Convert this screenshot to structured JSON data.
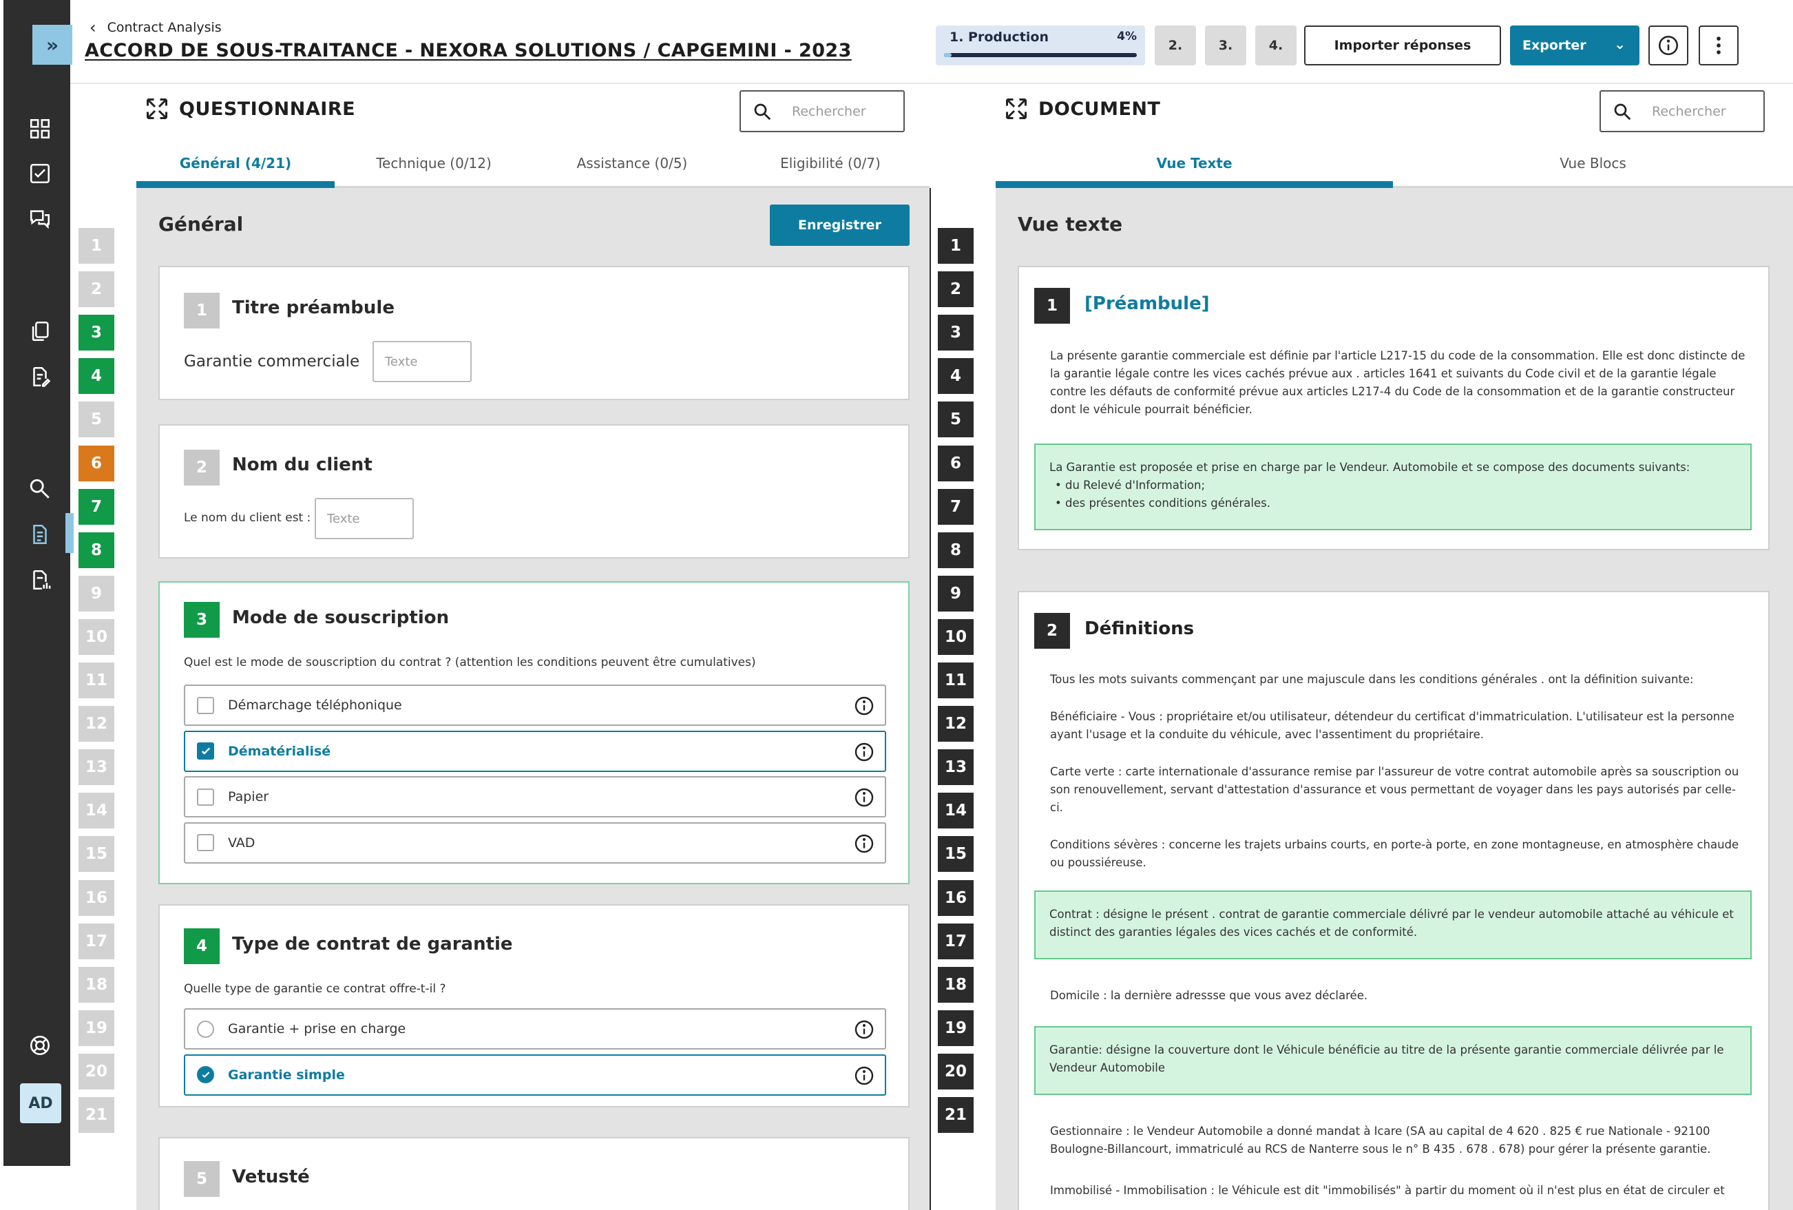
{
  "header": {
    "breadcrumb": "Contract Analysis",
    "title": "ACCORD DE SOUS-TRAITANCE - NEXORA SOLUTIONS / CAPGEMINI - 2023",
    "production_label": "1. Production",
    "production_pct": "4%",
    "production_progress": 0.04,
    "steps": [
      "2.",
      "3.",
      "4."
    ],
    "import_label": "Importer réponses",
    "export_label": "Exporter"
  },
  "sidebar": {
    "expand_glyph": "»",
    "avatar": "AD",
    "icons": [
      "grid-icon",
      "checkbox-icon",
      "chat-icon",
      "copy-icon",
      "file-edit-icon",
      "search-icon",
      "file-list-icon",
      "file-chart-icon",
      "help-icon"
    ]
  },
  "questionnaire": {
    "heading": "QUESTIONNAIRE",
    "search_placeholder": "Rechercher",
    "tabs": [
      "Général (4/21)",
      "Technique (0/12)",
      "Assistance (0/5)",
      "Eligibilité (0/7)"
    ],
    "section_title": "Général",
    "save_label": "Enregistrer",
    "questions": [
      {
        "num": "1",
        "title": "Titre préambule",
        "field_label": "Garantie commerciale",
        "placeholder": "Texte"
      },
      {
        "num": "2",
        "title": "Nom du client",
        "field_label": "Le nom du client est :",
        "placeholder": "Texte"
      },
      {
        "num": "3",
        "title": "Mode de souscription",
        "prompt": "Quel est le mode de souscription du contrat  ? (attention les conditions peuvent être cumulatives)",
        "options": [
          {
            "label": "Démarchage  téléphonique",
            "selected": false
          },
          {
            "label": "Dématérialisé",
            "selected": true
          },
          {
            "label": "Papier",
            "selected": false
          },
          {
            "label": "VAD",
            "selected": false
          }
        ]
      },
      {
        "num": "4",
        "title": "Type de contrat de garantie",
        "prompt": "Quelle type de garantie ce contrat offre-t-il ?",
        "options": [
          {
            "label": "Garantie + prise en charge",
            "selected": false
          },
          {
            "label": "Garantie simple",
            "selected": true
          }
        ]
      },
      {
        "num": "5",
        "title": "Vetusté"
      }
    ],
    "numbers": [
      "1",
      "2",
      "3",
      "4",
      "5",
      "6",
      "7",
      "8",
      "9",
      "10",
      "11",
      "12",
      "13",
      "14",
      "15",
      "16",
      "17",
      "18",
      "19",
      "20",
      "21"
    ],
    "number_status": [
      "gray",
      "gray",
      "green",
      "green",
      "gray",
      "orange",
      "green",
      "green",
      "gray",
      "gray",
      "gray",
      "gray",
      "gray",
      "gray",
      "gray",
      "gray",
      "gray",
      "gray",
      "gray",
      "gray",
      "gray"
    ]
  },
  "document": {
    "heading": "DOCUMENT",
    "search_placeholder": "Rechercher",
    "tabs": [
      "Vue Texte",
      "Vue Blocs"
    ],
    "section_title": "Vue texte",
    "numbers": [
      "1",
      "2",
      "3",
      "4",
      "5",
      "6",
      "7",
      "8",
      "9",
      "10",
      "11",
      "12",
      "13",
      "14",
      "15",
      "16",
      "17",
      "18",
      "19",
      "20",
      "21"
    ],
    "blocks": [
      {
        "num": "1",
        "title": "[Préambule]",
        "paragraphs": [
          "La présente garantie commerciale est définie par l'article L217-15 du code de la consommation. Elle est donc distincte de la garantie légale contre les vices cachés prévue aux . articles 1641 et suivants du Code civil et de la garantie légale contre les défauts de conformité prévue aux articles L217-4 du Code de la consommation et de la garantie constructeur dont le véhicule pourrait bénéficier."
        ],
        "highlight": {
          "text": "La Garantie est proposée et prise en charge par le Vendeur. Automobile et se compose des documents suivants:",
          "items": [
            "du Relevé d'Information;",
            "des présentes conditions générales."
          ]
        }
      },
      {
        "num": "2",
        "title": "Définitions",
        "paragraphs": [
          "Tous les mots suivants commençant par une majuscule dans les conditions générales . ont la définition suivante:",
          "Bénéficiaire - Vous : propriétaire et/ou utilisateur, détendeur du certificat d'immatriculation. L'utilisateur est la personne ayant l'usage et la conduite du véhicule, avec l'assentiment du propriétaire.",
          "Carte verte : carte internationale d'assurance remise par l'assureur de votre contrat automobile après sa souscription ou son renouvellement, servant d'attestation d'assurance et vous permettant de voyager dans les pays autorisés par celle-ci.",
          "Conditions sévères : concerne les trajets urbains courts, en porte-à porte, en zone montagneuse, en atmosphère chaude ou poussiéreuse.",
          "Contrat : désigne le présent . contrat de garantie commerciale délivré par le vendeur automobile attaché au véhicule et distinct des garanties légales des vices cachés et de conformité.",
          "Domicile : la dernière adressse que vous avez déclarée.",
          "Garantie: désigne la couverture dont le Véhicule bénéficie au titre de la présente garantie commerciale délivrée par le Vendeur Automobile",
          "Gestionnaire : le Vendeur Automobile a donné mandat  à Icare (SA au capital de 4 620 . 825 € rue Nationale - 92100 Boulogne-Billancourt, immatriculé au RCS de Nanterre sous le n° B 435 . 678 . 678) pour gérer la présente garantie.",
          "Immobilisé -  Immobilisation : le Véhicule est dit \"immobilisés\" à partir du moment où il n'est plus en état de circuler et"
        ]
      }
    ]
  }
}
